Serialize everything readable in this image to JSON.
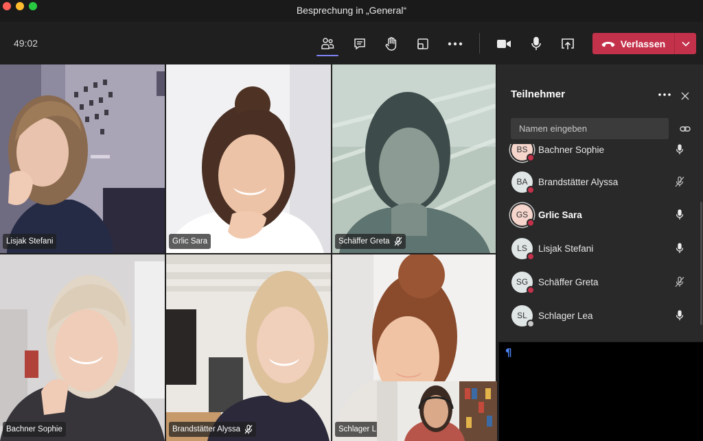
{
  "window": {
    "title": "Besprechung in „General“"
  },
  "toolbar": {
    "timer": "49:02",
    "leave_label": "Verlassen",
    "icons": [
      "people-icon",
      "chat-icon",
      "raise-hand-icon",
      "share-tray-icon",
      "more-icon",
      "camera-icon",
      "microphone-icon",
      "share-screen-icon"
    ],
    "leave_color": "#c4314b",
    "active_accent": "#7f85f5"
  },
  "videos": [
    {
      "name": "Lisjak Stefani",
      "muted": false
    },
    {
      "name": "Grlic Sara",
      "muted": false
    },
    {
      "name": "Schäffer Greta",
      "muted": true
    },
    {
      "name": "Bachner Sophie",
      "muted": false
    },
    {
      "name": "Brandstätter Alyssa",
      "muted": true
    },
    {
      "name": "Schlager L",
      "muted": false
    }
  ],
  "participants_panel": {
    "title": "Teilnehmer",
    "search_placeholder": "Namen eingeben",
    "participants": [
      {
        "initials": "BS",
        "name": "Bachner Sophie",
        "mic": "on"
      },
      {
        "initials": "BA",
        "name": "Brandstätter Alyssa",
        "mic": "muted"
      },
      {
        "initials": "GS",
        "name": "Grlic Sara",
        "mic": "on"
      },
      {
        "initials": "LS",
        "name": "Lisjak Stefani",
        "mic": "on"
      },
      {
        "initials": "SG",
        "name": "Schäffer Greta",
        "mic": "muted"
      },
      {
        "initials": "SL",
        "name": "Schlager Lea",
        "mic": "on"
      }
    ]
  },
  "editor": {
    "mark": "¶"
  }
}
